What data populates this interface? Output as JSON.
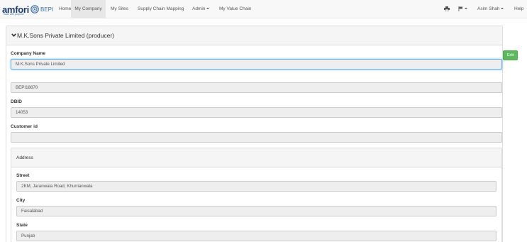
{
  "brand": {
    "name": "amfori",
    "tagline": "Trade with purpose",
    "product": "BEPI",
    "color": "#1b3a6b"
  },
  "nav": {
    "links": [
      {
        "label": "Home",
        "active": false
      },
      {
        "label": "My Company",
        "active": true
      },
      {
        "label": "My Sites",
        "active": false
      },
      {
        "label": "Supply Chain Mapping",
        "active": false
      },
      {
        "label": "Admin",
        "active": false,
        "dropdown": true
      },
      {
        "label": "My Value Chain",
        "active": false
      }
    ],
    "right": {
      "print_icon": "print-icon",
      "flag_icon": "flag-icon",
      "user": "Asim Shah",
      "help": "Help"
    }
  },
  "company": {
    "heading": "M.K.Sons Private Limited (producer)",
    "edit_label": "Edit",
    "edit_color": "#5cb85c",
    "name_label": "Company Name",
    "name_value": "M.K.Sons Private Limited",
    "bepi_value": "BEPI18870",
    "dbid_label": "DBID",
    "dbid_value": "14053",
    "customer_label": "Customer id",
    "customer_value": ""
  },
  "address": {
    "heading": "Address",
    "street_label": "Street",
    "street_value": "2KM, Jaranwala Road, Khurrianwala",
    "city_label": "City",
    "city_value": "Faisalabad",
    "state_label": "State",
    "state_value": "Punjab"
  }
}
